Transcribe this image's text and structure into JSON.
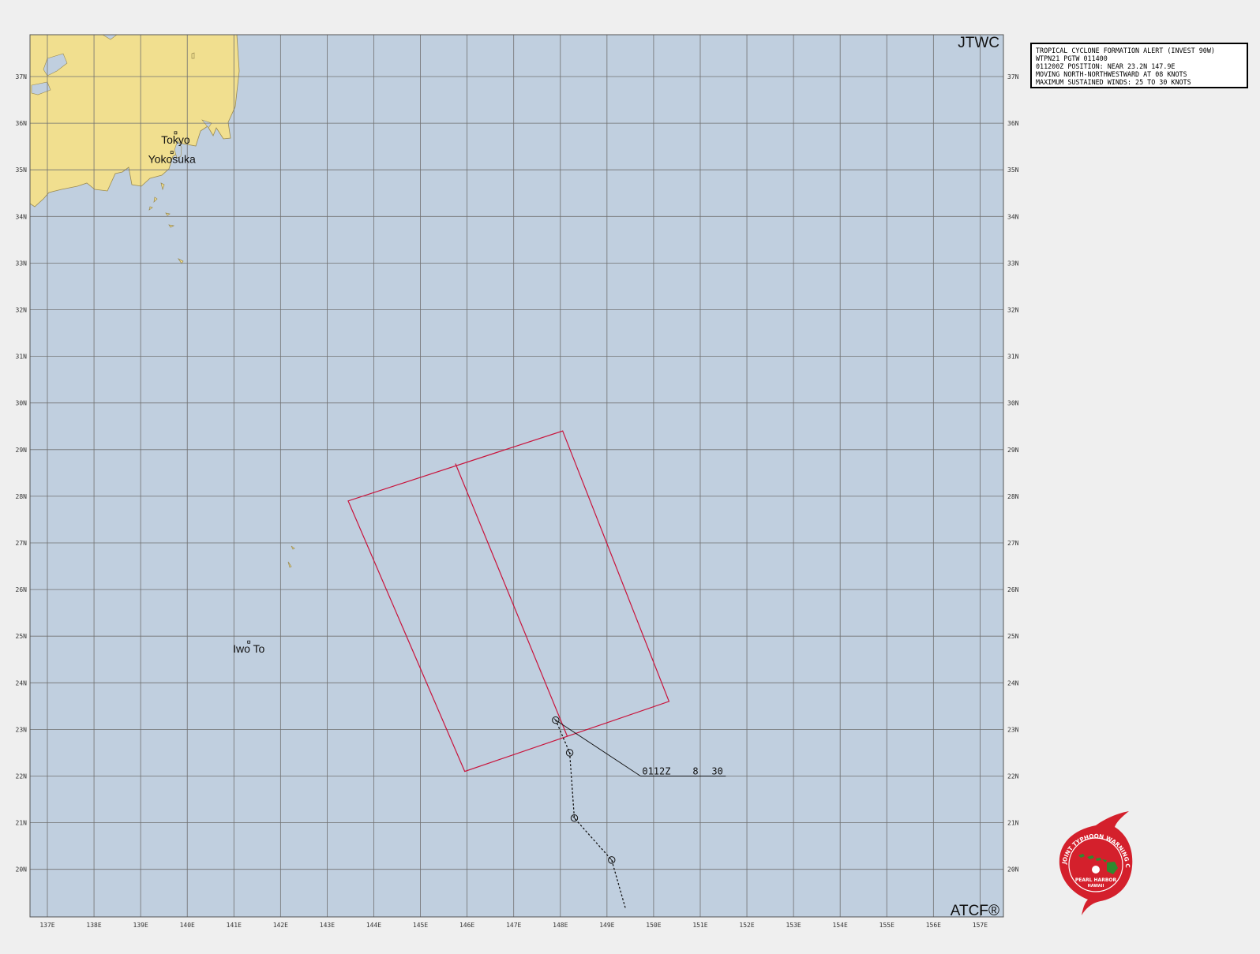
{
  "map": {
    "brand_top": "JTWC",
    "brand_bottom": "ATCF®",
    "lon_labels": [
      "137E",
      "138E",
      "139E",
      "140E",
      "141E",
      "142E",
      "143E",
      "144E",
      "145E",
      "146E",
      "147E",
      "148E",
      "149E",
      "150E",
      "151E",
      "152E",
      "153E",
      "154E",
      "155E",
      "156E",
      "157E"
    ],
    "lat_labels": [
      "37N",
      "36N",
      "35N",
      "34N",
      "33N",
      "32N",
      "31N",
      "30N",
      "29N",
      "28N",
      "27N",
      "26N",
      "25N",
      "24N",
      "23N",
      "22N",
      "21N",
      "20N"
    ],
    "places": [
      {
        "name": "Tokyo",
        "lat": 35.7,
        "lon": 139.75
      },
      {
        "name": "Yokosuka",
        "lat": 35.28,
        "lon": 139.67
      },
      {
        "name": "Iwo To",
        "lat": 24.78,
        "lon": 141.32
      }
    ],
    "colors": {
      "ocean": "#c0cfdf",
      "land": "#f1df8f",
      "grid": "#707070",
      "alert_box": "#c8143c",
      "track": "#111111"
    }
  },
  "alert": {
    "lines": [
      "TROPICAL CYCLONE FORMATION ALERT (INVEST 90W)",
      "WTPN21 PGTW 011400",
      "011200Z POSITION: NEAR 23.2N 147.9E",
      "MOVING NORTH-NORTHWESTWARD AT 08 KNOTS",
      "MAXIMUM SUSTAINED WINDS: 25 TO 30 KNOTS"
    ],
    "box_corners": [
      {
        "lat": 29.4,
        "lon": 148.05
      },
      {
        "lat": 23.6,
        "lon": 150.33
      },
      {
        "lat": 22.1,
        "lon": 145.95
      },
      {
        "lat": 27.9,
        "lon": 143.45
      }
    ],
    "box_midline": [
      {
        "lat": 28.7,
        "lon": 145.75
      },
      {
        "lat": 22.85,
        "lon": 148.15
      }
    ]
  },
  "track": {
    "fixes": [
      {
        "lat": 23.2,
        "lon": 147.9
      },
      {
        "lat": 22.5,
        "lon": 148.2
      },
      {
        "lat": 21.1,
        "lon": 148.3
      },
      {
        "lat": 20.2,
        "lon": 149.1
      }
    ],
    "tail": {
      "lat": 19.15,
      "lon": 149.4
    },
    "label_lines": [
      {
        "time": "0112Z",
        "speed": "8",
        "winds": "30"
      }
    ],
    "label_anchor": {
      "lat": 22.0,
      "lon": 149.72
    }
  },
  "logo": {
    "ring_text": "JOINT TYPHOON WARNING CENTER",
    "line1": "PEARL HARBOR",
    "line2": "HAWAII"
  }
}
